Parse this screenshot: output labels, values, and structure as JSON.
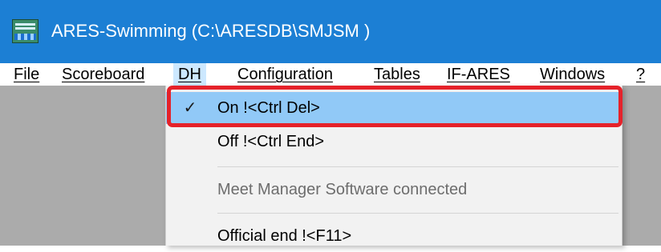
{
  "window": {
    "title": "ARES-Swimming (C:\\ARESDB\\SMJSM )",
    "icon": "ares-app-icon"
  },
  "menubar": {
    "items": [
      "File",
      "Scoreboard",
      "DH",
      "Configuration",
      "Tables",
      "IF-ARES",
      "Windows",
      "?"
    ],
    "open_item": "DH"
  },
  "dropdown": {
    "items": [
      {
        "label": "On  !<Ctrl Del>",
        "checked": true,
        "state": "highlighted"
      },
      {
        "label": "Off  !<Ctrl End>",
        "checked": false,
        "state": "normal"
      },
      {
        "label": "Meet Manager Software connected",
        "checked": false,
        "state": "disabled"
      },
      {
        "label": "Official end  !<F11>",
        "checked": false,
        "state": "normal"
      }
    ],
    "check_glyph": "✓",
    "check_icon": "checkmark-icon"
  },
  "colors": {
    "titlebar": "#1c7fd4",
    "workspace": "#ababab",
    "menu_highlight": "#91c9f7",
    "annotation": "#e5222a"
  }
}
